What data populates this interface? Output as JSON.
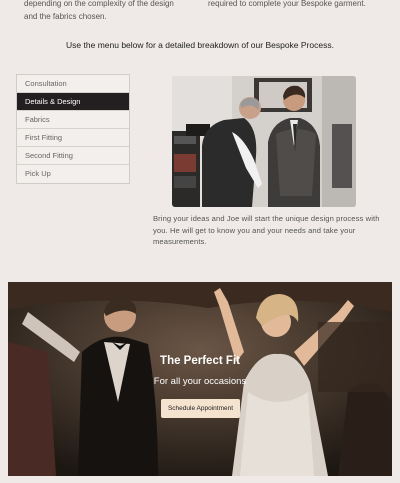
{
  "intro": {
    "left_text": "depending on the complexity of the design and the fabrics chosen.",
    "right_text": "required to complete your Bespoke garment."
  },
  "menu_note": "Use the menu below for a detailed breakdown of our Bespoke Process.",
  "menu": {
    "items": [
      {
        "label": "Consultation",
        "active": false
      },
      {
        "label": "Details & Design",
        "active": true
      },
      {
        "label": "Fabrics",
        "active": false
      },
      {
        "label": "First Fitting",
        "active": false
      },
      {
        "label": "Second Fitting",
        "active": false
      },
      {
        "label": "Pick Up",
        "active": false
      }
    ]
  },
  "description": "Bring your ideas and Joe will start the unique design process with you. He will get to know you and your needs and take your measurements.",
  "hero": {
    "title": "The Perfect Fit",
    "subtitle": "For all your occasions",
    "button_label": "Schedule Appointment"
  },
  "colors": {
    "page_bg": "#efeae7",
    "menu_active_bg": "#231f20",
    "button_bg": "#f4e3cf"
  }
}
